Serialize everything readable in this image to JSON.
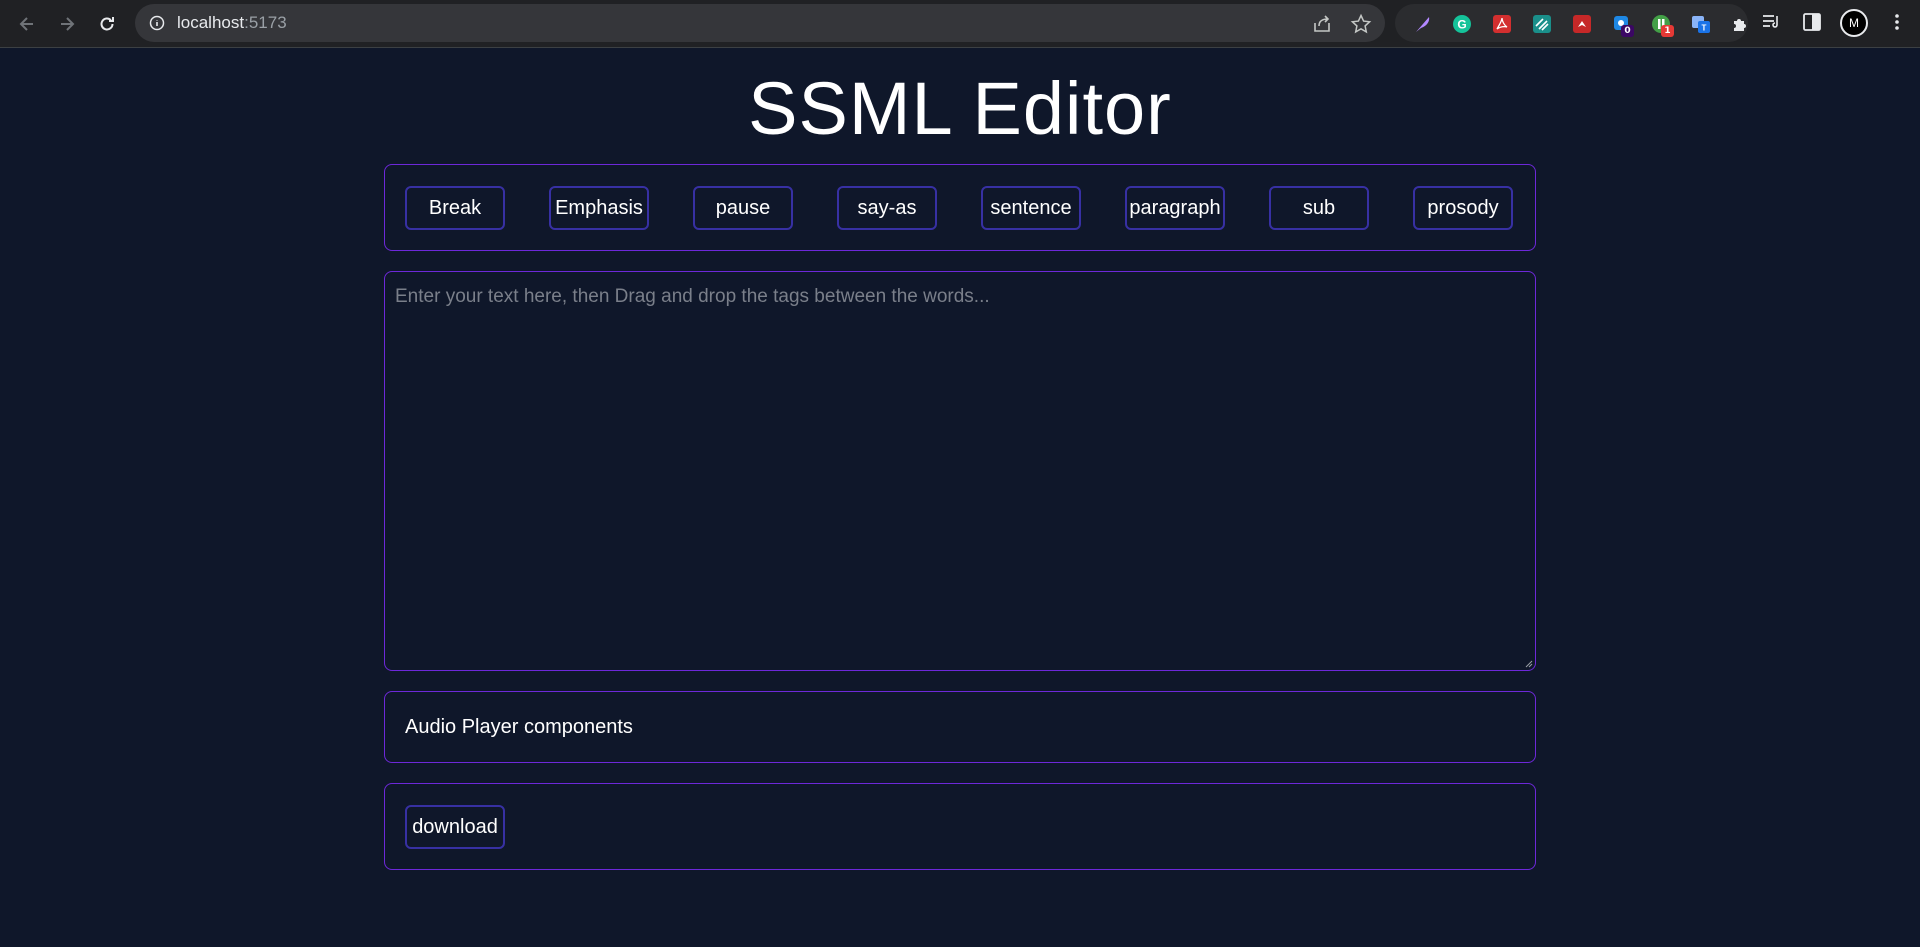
{
  "browser": {
    "url_host": "localhost",
    "url_port": ":5173",
    "extensions": [
      {
        "icon": "feather-extension-icon",
        "color": "#b388ff"
      },
      {
        "icon": "grammarly-icon",
        "color": "#15c39a"
      },
      {
        "icon": "adobe-acrobat-icon",
        "color": "#d32f2f"
      },
      {
        "icon": "stack-extension-icon",
        "color": "#1a8f8a"
      },
      {
        "icon": "shield-extension-icon",
        "color": "#c62828"
      },
      {
        "icon": "puzzle-blue-extension-icon",
        "color": "#1e88e5",
        "badge": "0"
      },
      {
        "icon": "green-extension-icon",
        "color": "#43a047",
        "badge": "1"
      },
      {
        "icon": "translate-extension-icon",
        "color": "#5c9ded"
      }
    ],
    "avatar_letter": "M"
  },
  "app": {
    "title": "SSML Editor",
    "tags": [
      "Break",
      "Emphasis",
      "pause",
      "say-as",
      "sentence",
      "paragraph",
      "sub",
      "prosody"
    ],
    "editor_placeholder": "Enter your text here, then Drag and drop the tags between the words...",
    "editor_value": "",
    "audio_label": "Audio Player components",
    "download_label": "download"
  },
  "colors": {
    "background": "#0f172a",
    "panel_border": "#6d28d9",
    "button_border": "#3730a3",
    "text": "#ffffff"
  }
}
